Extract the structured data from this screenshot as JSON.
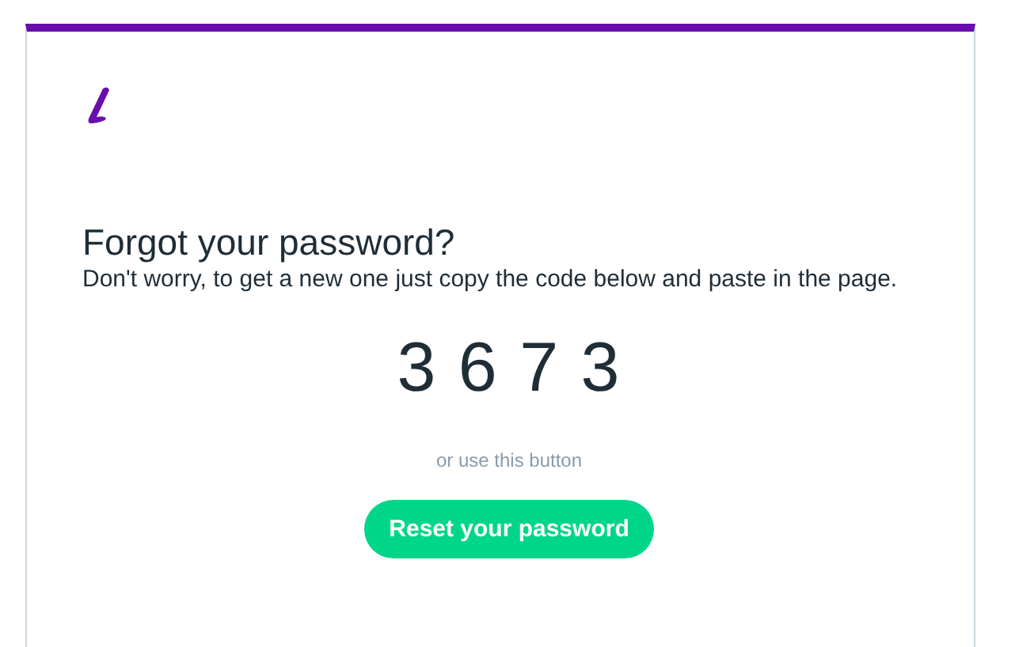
{
  "email": {
    "title": "Forgot your password?",
    "message": "Don't worry, to get a new one just copy the code below and paste in the page.",
    "code": "3 6 7 3",
    "hint": "or use this button",
    "button": "Reset your password"
  }
}
